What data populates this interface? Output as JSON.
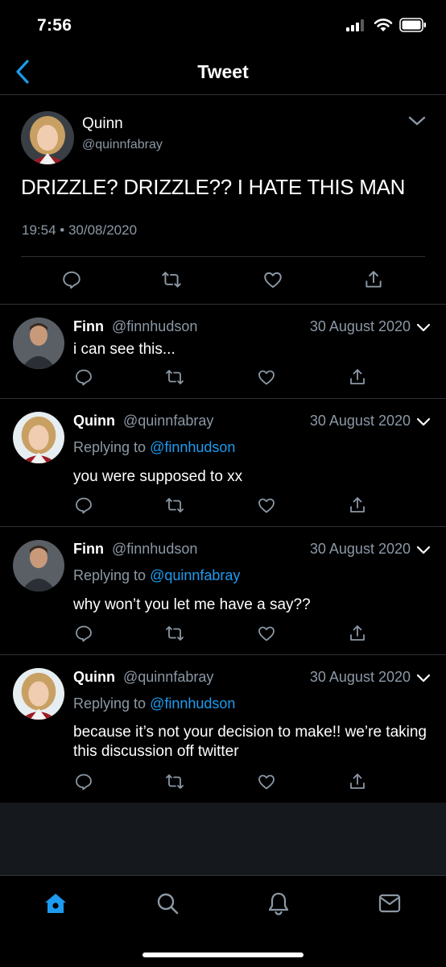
{
  "status_bar": {
    "time": "7:56"
  },
  "header": {
    "title": "Tweet",
    "back_icon": "chevron-left-icon"
  },
  "colors": {
    "background": "#000000",
    "accent": "#1d9bf0",
    "secondary_text": "#8b98a5",
    "divider": "#2f3336",
    "empty_area": "#15181c"
  },
  "main_tweet": {
    "name": "Quinn",
    "handle": "@quinnfabray",
    "text": "DRIZZLE? DRIZZLE?? I HATE THIS MAN",
    "datetime": "19:54 • 30/08/2020",
    "actions": [
      "reply-icon",
      "retweet-icon",
      "like-icon",
      "share-icon"
    ]
  },
  "replies": [
    {
      "name": "Finn",
      "handle": "@finnhudson",
      "date": "30 August 2020",
      "replying_prefix": "",
      "replying_to": "",
      "text": "i can see this..."
    },
    {
      "name": "Quinn",
      "handle": "@quinnfabray",
      "date": "30 August 2020",
      "replying_prefix": "Replying to ",
      "replying_to": "@finnhudson",
      "text": "you were supposed to xx"
    },
    {
      "name": "Finn",
      "handle": "@finnhudson",
      "date": "30 August 2020",
      "replying_prefix": "Replying to ",
      "replying_to": "@quinnfabray",
      "text": "why won’t you let me have a say??"
    },
    {
      "name": "Quinn",
      "handle": "@quinnfabray",
      "date": "30 August 2020",
      "replying_prefix": "Replying to ",
      "replying_to": "@finnhudson",
      "text": "because it’s not your decision to make!! we’re taking this discussion off twitter"
    }
  ],
  "tab_bar": {
    "items": [
      "home-icon",
      "search-icon",
      "notifications-icon",
      "messages-icon"
    ],
    "active": "home-icon"
  }
}
